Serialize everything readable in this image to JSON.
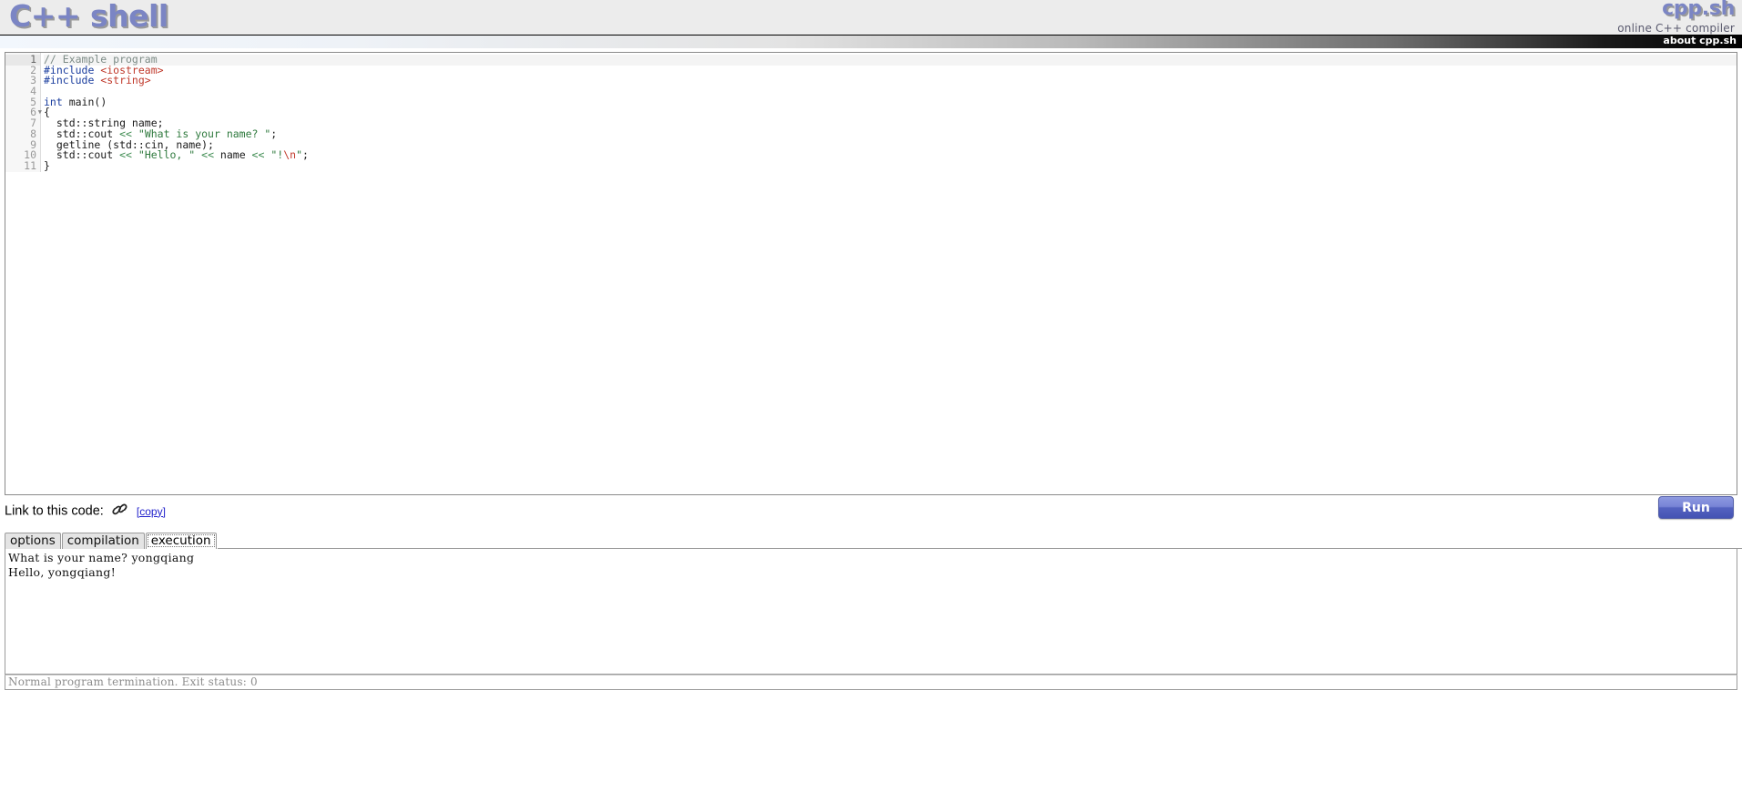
{
  "header": {
    "logo_text": "C++ shell",
    "brand_name": "cpp.sh",
    "brand_tagline": "online C++ compiler",
    "nav_link": "about cpp.sh"
  },
  "editor": {
    "active_line": 1,
    "fold_line": 6,
    "line_numbers": [
      "1",
      "2",
      "3",
      "4",
      "5",
      "6",
      "7",
      "8",
      "9",
      "10",
      "11"
    ],
    "lines": [
      {
        "n": "1",
        "tokens": [
          {
            "t": "// Example program",
            "c": "c-com"
          }
        ]
      },
      {
        "n": "2",
        "tokens": [
          {
            "t": "#include ",
            "c": "c-pre"
          },
          {
            "t": "<iostream>",
            "c": "c-inc"
          }
        ]
      },
      {
        "n": "3",
        "tokens": [
          {
            "t": "#include ",
            "c": "c-pre"
          },
          {
            "t": "<string>",
            "c": "c-inc"
          }
        ]
      },
      {
        "n": "4",
        "tokens": [
          {
            "t": "",
            "c": "c-plain"
          }
        ]
      },
      {
        "n": "5",
        "tokens": [
          {
            "t": "int",
            "c": "c-kw"
          },
          {
            "t": " main()",
            "c": "c-plain"
          }
        ]
      },
      {
        "n": "6",
        "tokens": [
          {
            "t": "{",
            "c": "c-plain"
          }
        ]
      },
      {
        "n": "7",
        "tokens": [
          {
            "t": "  std::string name;",
            "c": "c-plain"
          }
        ]
      },
      {
        "n": "8",
        "tokens": [
          {
            "t": "  std::cout ",
            "c": "c-plain"
          },
          {
            "t": "<<",
            "c": "c-op"
          },
          {
            "t": " ",
            "c": "c-plain"
          },
          {
            "t": "\"What is your name? \"",
            "c": "c-str"
          },
          {
            "t": ";",
            "c": "c-plain"
          }
        ]
      },
      {
        "n": "9",
        "tokens": [
          {
            "t": "  getline (std::cin, name);",
            "c": "c-plain"
          }
        ]
      },
      {
        "n": "10",
        "tokens": [
          {
            "t": "  std::cout ",
            "c": "c-plain"
          },
          {
            "t": "<<",
            "c": "c-op"
          },
          {
            "t": " ",
            "c": "c-plain"
          },
          {
            "t": "\"Hello, \"",
            "c": "c-str"
          },
          {
            "t": " ",
            "c": "c-plain"
          },
          {
            "t": "<<",
            "c": "c-op"
          },
          {
            "t": " name ",
            "c": "c-plain"
          },
          {
            "t": "<<",
            "c": "c-op"
          },
          {
            "t": " ",
            "c": "c-plain"
          },
          {
            "t": "\"",
            "c": "c-str"
          },
          {
            "t": "!",
            "c": "c-str"
          },
          {
            "t": "\\n",
            "c": "c-esc"
          },
          {
            "t": "\"",
            "c": "c-str"
          },
          {
            "t": ";",
            "c": "c-plain"
          }
        ]
      },
      {
        "n": "11",
        "tokens": [
          {
            "t": "}",
            "c": "c-plain"
          }
        ]
      }
    ]
  },
  "link_row": {
    "label": "Link to this code:",
    "copy_label": "[copy]",
    "run_label": "Run"
  },
  "tabs": [
    {
      "label": "options",
      "active": false
    },
    {
      "label": "compilation",
      "active": false
    },
    {
      "label": "execution",
      "active": true
    }
  ],
  "output": {
    "text": "What is your name? yongqiang\nHello, yongqiang!",
    "status": "Normal program termination. Exit status: 0"
  },
  "colors": {
    "accent": "#7b85c4",
    "run_button": "#5462c0",
    "link": "#2222cc",
    "comment": "#7d8b86",
    "preprocessor": "#1a3d9e",
    "include_path": "#c0392b",
    "string": "#2f7a3e",
    "operator": "#3b8a4e",
    "escape": "#c0392b",
    "status_text": "#8d8d8d"
  }
}
